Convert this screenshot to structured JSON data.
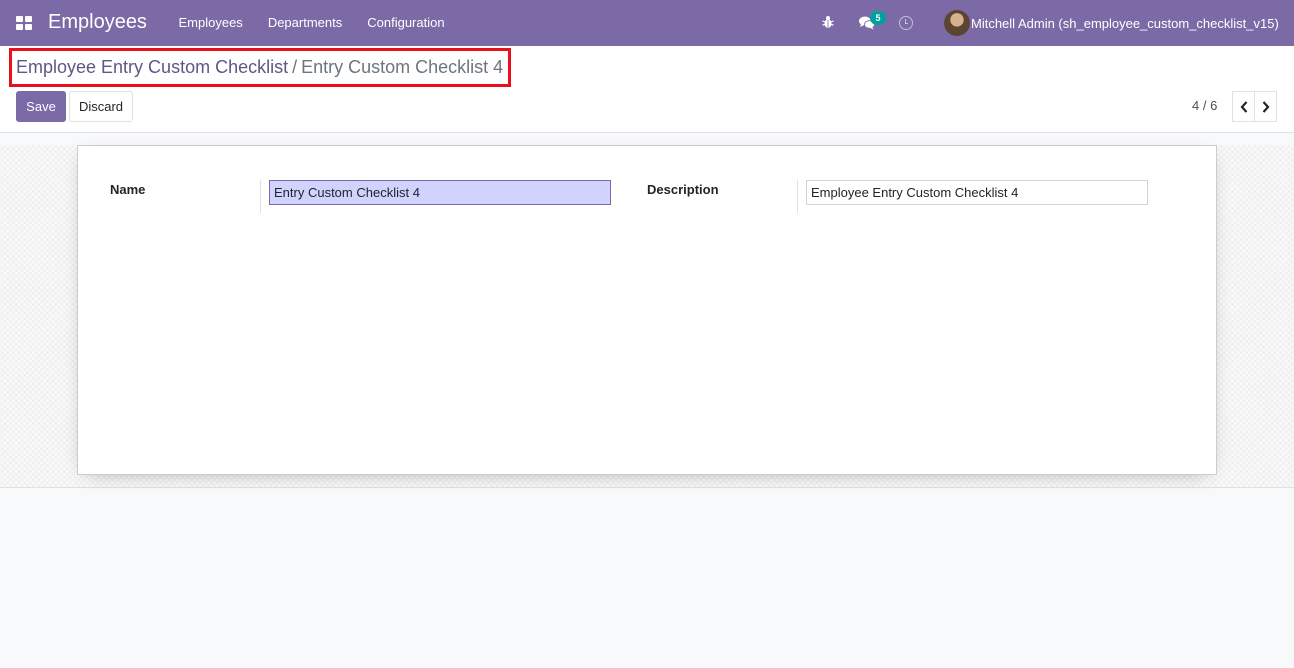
{
  "app": {
    "title": "Employees"
  },
  "nav": {
    "items": [
      "Employees",
      "Departments",
      "Configuration"
    ]
  },
  "systray": {
    "debug_icon": "bug-icon",
    "messages_icon": "comments-icon",
    "messages_count": "5",
    "activity_icon": "clock-icon",
    "user_name": "Mitchell Admin (sh_employee_custom_checklist_v15)"
  },
  "breadcrumb": {
    "parent": "Employee Entry Custom Checklist",
    "separator": "/",
    "current": "Entry Custom Checklist 4"
  },
  "actions": {
    "save": "Save",
    "discard": "Discard"
  },
  "pager": {
    "value": "4 / 6",
    "prev_icon": "chevron-left-icon",
    "next_icon": "chevron-right-icon"
  },
  "form": {
    "name_label": "Name",
    "name_value": "Entry Custom Checklist 4",
    "description_label": "Description",
    "description_value": "Employee Entry Custom Checklist 4"
  },
  "colors": {
    "brand": "#7c6aa6",
    "highlight_box": "#e8101a",
    "badge": "#00a09d",
    "focused_field": "#d2d2ff"
  }
}
